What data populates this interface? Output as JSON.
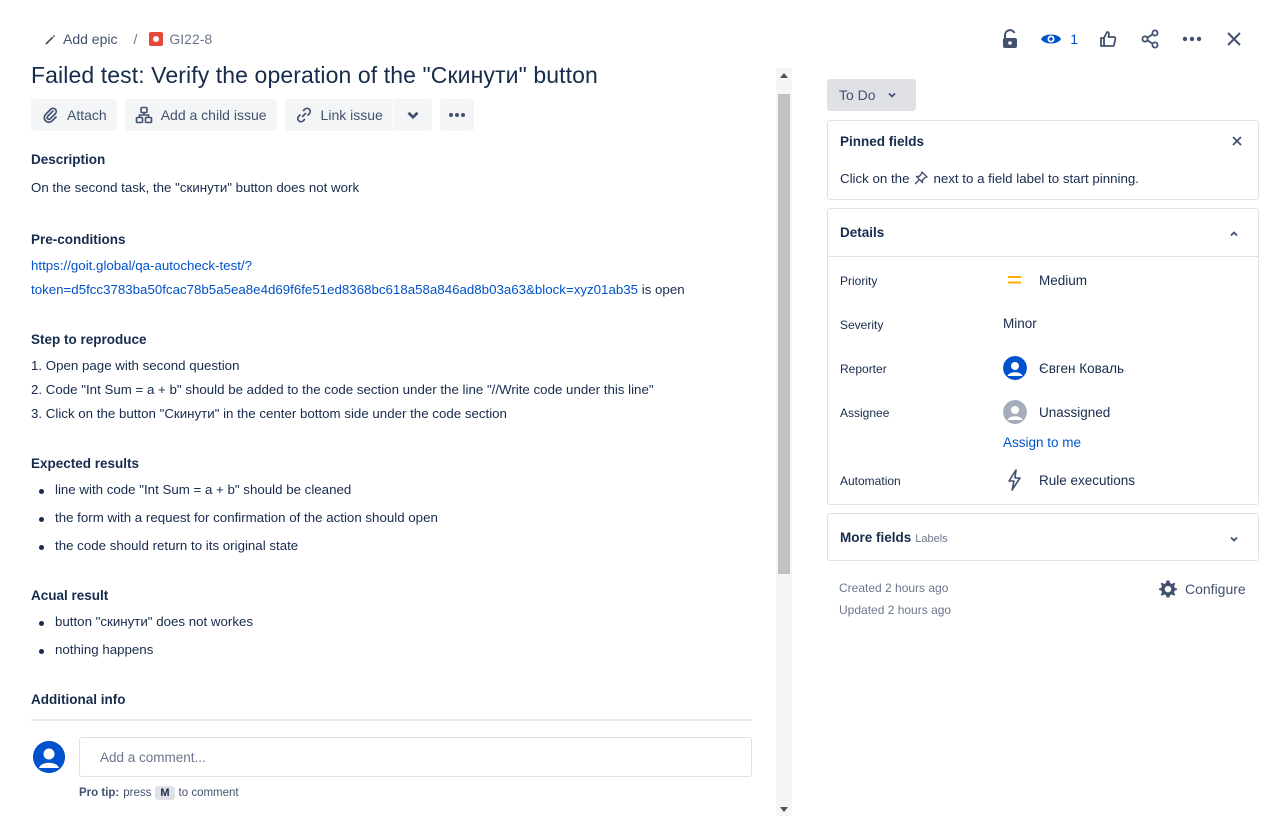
{
  "breadcrumb": {
    "epic_label": "Add epic",
    "separator": "/",
    "issue_key": "GI22-8"
  },
  "top_actions": {
    "watch_count": "1",
    "icons": [
      "lock-icon",
      "eye-icon",
      "thumbs-up-icon",
      "share-icon",
      "more-icon",
      "close-icon"
    ]
  },
  "issue": {
    "title": "Failed test: Verify the operation of the \"Скинути\" button"
  },
  "toolbar": {
    "attach_label": "Attach",
    "child_issue_label": "Add a child issue",
    "link_issue_label": "Link issue"
  },
  "body": {
    "description_heading": "Description",
    "description_text": "On the second task, the \"скинути\" button does not work",
    "preconditions_heading": "Pre-conditions",
    "preconditions_link_line1": "https://goit.global/qa-autocheck-test/?",
    "preconditions_link_line2": "token=d5fcc3783ba50fcac78b5a5ea8e4d69f6fe51ed8368bc618a58a846ad8b03a63&block=xyz01ab35",
    "preconditions_suffix": " is open",
    "steps_heading": "Step to reproduce",
    "steps": [
      "1. Open page with second question",
      "2. Code \"Int Sum = a + b\" should be added to the code section under the line \"//Write code under this line\"",
      "3. Click on the button \"Скинути\" in the center bottom side under the code section"
    ],
    "expected_heading": "Expected results",
    "expected": [
      "line with code \"Int Sum = a + b\" should be cleaned",
      "the form with a request for confirmation of the action should open",
      "the code should return to its original state"
    ],
    "actual_heading": "Acual result",
    "actual": [
      "button \"скинути\" does not workes",
      "nothing happens"
    ],
    "additional_heading": "Additional info"
  },
  "comment": {
    "placeholder": "Add a comment...",
    "pro_tip_label": "Pro tip:",
    "pro_tip_press": "press",
    "pro_tip_key": "M",
    "pro_tip_suffix": "to comment"
  },
  "sidebar": {
    "status": "To Do",
    "pinned_title": "Pinned fields",
    "pinned_text_before": "Click on the",
    "pinned_text_after": "next to a field label to start pinning.",
    "details_title": "Details",
    "fields": {
      "priority_label": "Priority",
      "priority_value": "Medium",
      "severity_label": "Severity",
      "severity_value": "Minor",
      "reporter_label": "Reporter",
      "reporter_value": "Євген Коваль",
      "assignee_label": "Assignee",
      "assignee_value": "Unassigned",
      "assign_to_me": "Assign to me",
      "automation_label": "Automation",
      "automation_value": "Rule executions"
    },
    "more_fields_title": "More fields",
    "more_fields_sub": "Labels",
    "created": "Created 2 hours ago",
    "updated": "Updated 2 hours ago",
    "configure": "Configure"
  },
  "colors": {
    "link": "#0052CC",
    "priority_medium": "#FFAB00",
    "bug": "#E5493A"
  }
}
